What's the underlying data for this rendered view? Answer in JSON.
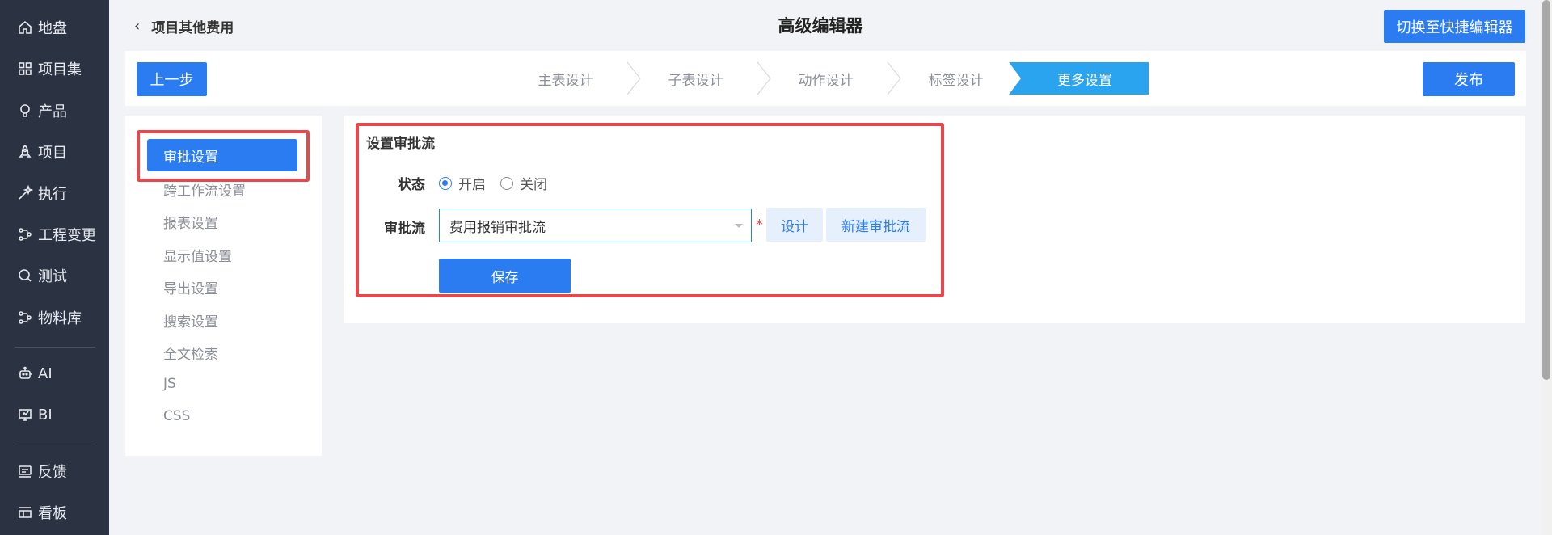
{
  "sidebar": {
    "items": [
      {
        "label": "地盘",
        "icon": "home-icon"
      },
      {
        "label": "项目集",
        "icon": "grid-icon"
      },
      {
        "label": "产品",
        "icon": "lightbulb-icon"
      },
      {
        "label": "项目",
        "icon": "rocket-icon"
      },
      {
        "label": "执行",
        "icon": "wand-icon"
      },
      {
        "label": "工程变更",
        "icon": "flow-icon"
      },
      {
        "label": "测试",
        "icon": "search-icon"
      },
      {
        "label": "物料库",
        "icon": "flow-icon"
      },
      {
        "label": "AI",
        "icon": "robot-icon"
      },
      {
        "label": "BI",
        "icon": "presentation-icon"
      },
      {
        "label": "反馈",
        "icon": "feedback-icon"
      },
      {
        "label": "看板",
        "icon": "board-icon"
      }
    ]
  },
  "header": {
    "back_label": "项目其他费用",
    "title": "高级编辑器",
    "switch_label": "切换至快捷编辑器"
  },
  "stepbar": {
    "prev_label": "上一步",
    "publish_label": "发布",
    "steps": [
      "主表设计",
      "子表设计",
      "动作设计",
      "标签设计",
      "更多设置"
    ],
    "active_step": "更多设置"
  },
  "subnav": {
    "active": "审批设置",
    "items": [
      "跨工作流设置",
      "报表设置",
      "显示值设置",
      "导出设置",
      "搜索设置",
      "全文检索",
      "JS",
      "CSS"
    ]
  },
  "form": {
    "section_title": "设置审批流",
    "status_label": "状态",
    "status_on": "开启",
    "status_off": "关闭",
    "status_value": "开启",
    "flow_label": "审批流",
    "flow_value": "费用报销审批流",
    "required_mark": "*",
    "design_label": "设计",
    "new_flow_label": "新建审批流",
    "save_label": "保存"
  },
  "colors": {
    "primary": "#2b7cf0",
    "active_step": "#2ba4ef",
    "highlight": "#e5484d",
    "sidebar_bg": "#2b3242"
  }
}
